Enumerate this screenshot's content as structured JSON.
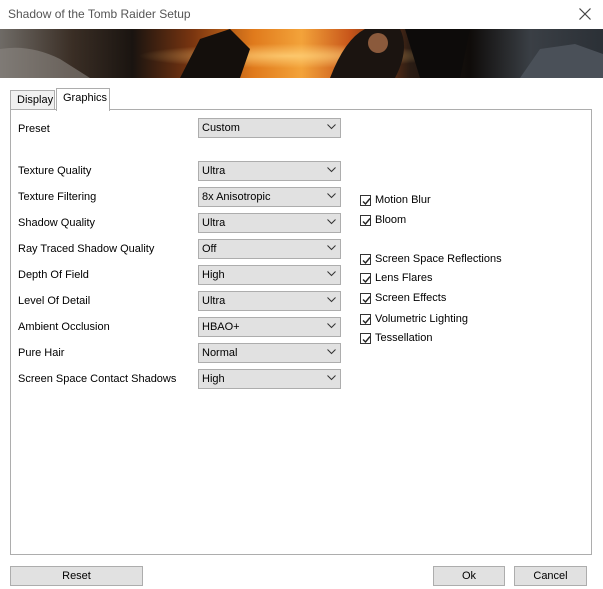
{
  "window": {
    "title": "Shadow of the Tomb Raider Setup"
  },
  "tabs": [
    {
      "label": "Display",
      "active": false
    },
    {
      "label": "Graphics",
      "active": true
    }
  ],
  "preset": {
    "label": "Preset",
    "value": "Custom"
  },
  "settings": [
    {
      "label": "Texture Quality",
      "value": "Ultra"
    },
    {
      "label": "Texture Filtering",
      "value": "8x Anisotropic"
    },
    {
      "label": "Shadow Quality",
      "value": "Ultra"
    },
    {
      "label": "Ray Traced Shadow Quality",
      "value": "Off"
    },
    {
      "label": "Depth Of Field",
      "value": "High"
    },
    {
      "label": "Level Of Detail",
      "value": "Ultra"
    },
    {
      "label": "Ambient Occlusion",
      "value": "HBAO+"
    },
    {
      "label": "Pure Hair",
      "value": "Normal"
    },
    {
      "label": "Screen Space Contact Shadows",
      "value": "High"
    }
  ],
  "checkboxes": [
    {
      "label": "Motion Blur",
      "checked": true
    },
    {
      "label": "Bloom",
      "checked": true
    },
    {
      "label": "Screen Space Reflections",
      "checked": true
    },
    {
      "label": "Lens Flares",
      "checked": true
    },
    {
      "label": "Screen Effects",
      "checked": true
    },
    {
      "label": "Volumetric Lighting",
      "checked": true
    },
    {
      "label": "Tessellation",
      "checked": true
    }
  ],
  "buttons": {
    "reset": "Reset",
    "ok": "Ok",
    "cancel": "Cancel"
  }
}
